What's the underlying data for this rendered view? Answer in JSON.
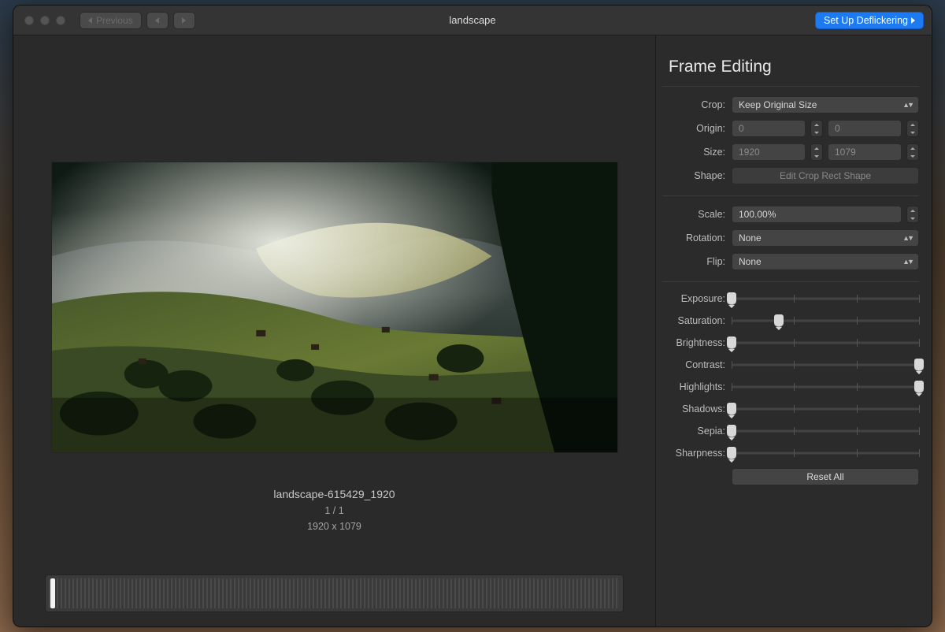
{
  "titlebar": {
    "prev_label": "Previous",
    "window_title": "landscape",
    "action_label": "Set Up Deflickering"
  },
  "preview": {
    "filename": "landscape-615429_1920",
    "index": "1 / 1",
    "dimensions": "1920 x 1079"
  },
  "panel": {
    "title": "Frame Editing",
    "crop": {
      "label": "Crop:",
      "mode": "Keep Original Size",
      "origin_label": "Origin:",
      "origin_x": "0",
      "origin_y": "0",
      "size_label": "Size:",
      "size_w": "1920",
      "size_h": "1079",
      "shape_label": "Shape:",
      "shape_button": "Edit Crop Rect Shape"
    },
    "transform": {
      "scale_label": "Scale:",
      "scale_value": "100.00%",
      "rotation_label": "Rotation:",
      "rotation_value": "None",
      "flip_label": "Flip:",
      "flip_value": "None"
    },
    "sliders": [
      {
        "label": "Exposure:",
        "pos": 0.0
      },
      {
        "label": "Saturation:",
        "pos": 0.25
      },
      {
        "label": "Brightness:",
        "pos": 0.0
      },
      {
        "label": "Contrast:",
        "pos": 1.0
      },
      {
        "label": "Highlights:",
        "pos": 1.0
      },
      {
        "label": "Shadows:",
        "pos": 0.0
      },
      {
        "label": "Sepia:",
        "pos": 0.0
      },
      {
        "label": "Sharpness:",
        "pos": 0.0
      }
    ],
    "reset_label": "Reset All"
  }
}
